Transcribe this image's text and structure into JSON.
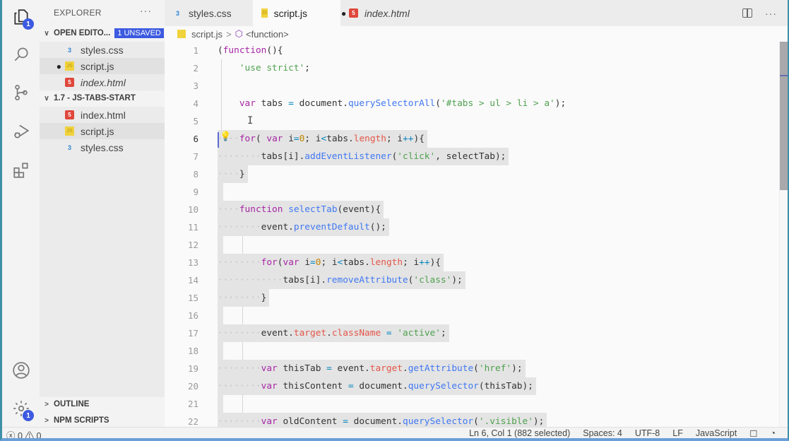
{
  "activity_bar": {
    "items": [
      {
        "name": "explorer-icon",
        "badge": "1",
        "active": true
      },
      {
        "name": "search-icon"
      },
      {
        "name": "source-control-icon"
      },
      {
        "name": "run-debug-icon"
      },
      {
        "name": "extensions-icon"
      }
    ],
    "bottom": [
      {
        "name": "account-icon"
      },
      {
        "name": "settings-gear-icon",
        "badge": "1"
      }
    ]
  },
  "sidebar": {
    "title": "EXPLORER",
    "more": "···",
    "open_editors": {
      "label": "OPEN EDITO...",
      "badge": "1 UNSAVED",
      "files": [
        {
          "name": "styles.css",
          "type": "css",
          "modified": false,
          "italic": false
        },
        {
          "name": "script.js",
          "type": "js",
          "modified": true,
          "italic": false
        },
        {
          "name": "index.html",
          "type": "html",
          "modified": false,
          "italic": true
        }
      ]
    },
    "folder": {
      "label": "1.7 - JS-TABS-START",
      "files": [
        {
          "name": "index.html",
          "type": "html"
        },
        {
          "name": "script.js",
          "type": "js"
        },
        {
          "name": "styles.css",
          "type": "css"
        }
      ]
    },
    "outline_label": "OUTLINE",
    "npm_label": "NPM SCRIPTS"
  },
  "tabs": [
    {
      "label": "styles.css",
      "type": "css",
      "active": false
    },
    {
      "label": "script.js",
      "type": "js",
      "active": true,
      "modified": "●"
    },
    {
      "label": "index.html",
      "type": "html",
      "active": false,
      "italic": true
    }
  ],
  "breadcrumb": {
    "file": "script.js",
    "separator": ">",
    "symbol": "<function>"
  },
  "editor": {
    "current_line": 6,
    "lines": [
      {
        "n": "1",
        "text": "(function(){"
      },
      {
        "n": "2",
        "text": "'use strict';"
      },
      {
        "n": "3",
        "text": ""
      },
      {
        "n": "4",
        "text": "var tabs = document.querySelectorAll('#tabs > ul > li > a');"
      },
      {
        "n": "5",
        "text": ""
      },
      {
        "n": "6",
        "text": "for( var i=0; i<tabs.length; i++){"
      },
      {
        "n": "7",
        "text": "tabs[i].addEventListener('click', selectTab);"
      },
      {
        "n": "8",
        "text": "}"
      },
      {
        "n": "9",
        "text": ""
      },
      {
        "n": "10",
        "text": "function selectTab(event){"
      },
      {
        "n": "11",
        "text": "event.preventDefault();"
      },
      {
        "n": "12",
        "text": ""
      },
      {
        "n": "13",
        "text": "for(var i=0; i<tabs.length; i++){"
      },
      {
        "n": "14",
        "text": "tabs[i].removeAttribute('class');"
      },
      {
        "n": "15",
        "text": "}"
      },
      {
        "n": "16",
        "text": ""
      },
      {
        "n": "17",
        "text": "event.target.className = 'active';"
      },
      {
        "n": "18",
        "text": ""
      },
      {
        "n": "19",
        "text": "var thisTab = event.target.getAttribute('href');"
      },
      {
        "n": "20",
        "text": "var thisContent = document.querySelector(thisTab);"
      },
      {
        "n": "21",
        "text": ""
      },
      {
        "n": "22",
        "text": "var oldContent = document.querySelector('.visible');"
      }
    ]
  },
  "statusbar": {
    "errors": "0",
    "warnings": "0",
    "position": "Ln 6, Col 1 (882 selected)",
    "spaces": "Spaces: 4",
    "encoding": "UTF-8",
    "eol": "LF",
    "language": "JavaScript"
  },
  "colors": {
    "accent": "#3c5ae0",
    "keyword": "#a626a4",
    "function": "#4078f2",
    "string": "#50a14f",
    "property": "#e45649"
  }
}
